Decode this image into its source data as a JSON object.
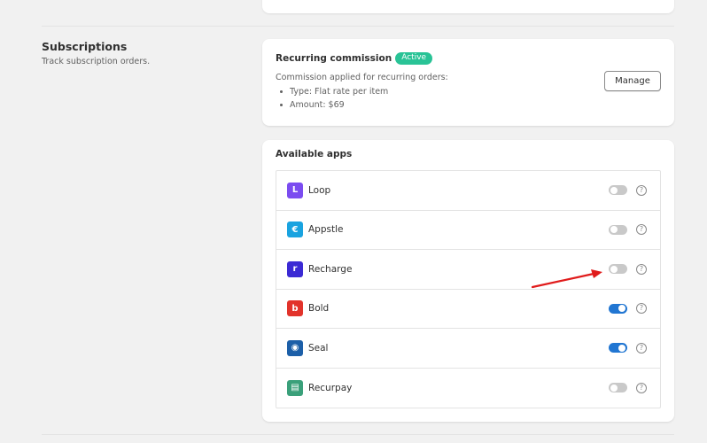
{
  "subscriptions": {
    "title": "Subscriptions",
    "description": "Track subscription orders."
  },
  "recurring_commission": {
    "title": "Recurring commission",
    "badge": "Active",
    "subtitle": "Commission applied for recurring orders:",
    "details": [
      "Type: Flat rate per item",
      "Amount: $69"
    ],
    "manage_label": "Manage"
  },
  "available_apps": {
    "title": "Available apps",
    "apps": [
      {
        "name": "Loop",
        "enabled": false,
        "icon_color": "#7b4cf0",
        "icon_glyph": "L"
      },
      {
        "name": "Appstle",
        "enabled": false,
        "icon_color": "#19a3e0",
        "icon_glyph": "€"
      },
      {
        "name": "Recharge",
        "enabled": false,
        "icon_color": "#3b2ad4",
        "icon_glyph": "r"
      },
      {
        "name": "Bold",
        "enabled": true,
        "icon_color": "#e2332b",
        "icon_glyph": "b"
      },
      {
        "name": "Seal",
        "enabled": true,
        "icon_color": "#1c5fa8",
        "icon_glyph": "◉"
      },
      {
        "name": "Recurpay",
        "enabled": false,
        "icon_color": "#3aa07a",
        "icon_glyph": "▤"
      }
    ],
    "help_glyph": "?"
  },
  "colors": {
    "badge_green": "#29c396",
    "toggle_on": "#2176d2",
    "toggle_off": "#c9c9c9",
    "arrow": "#e01b1b"
  }
}
